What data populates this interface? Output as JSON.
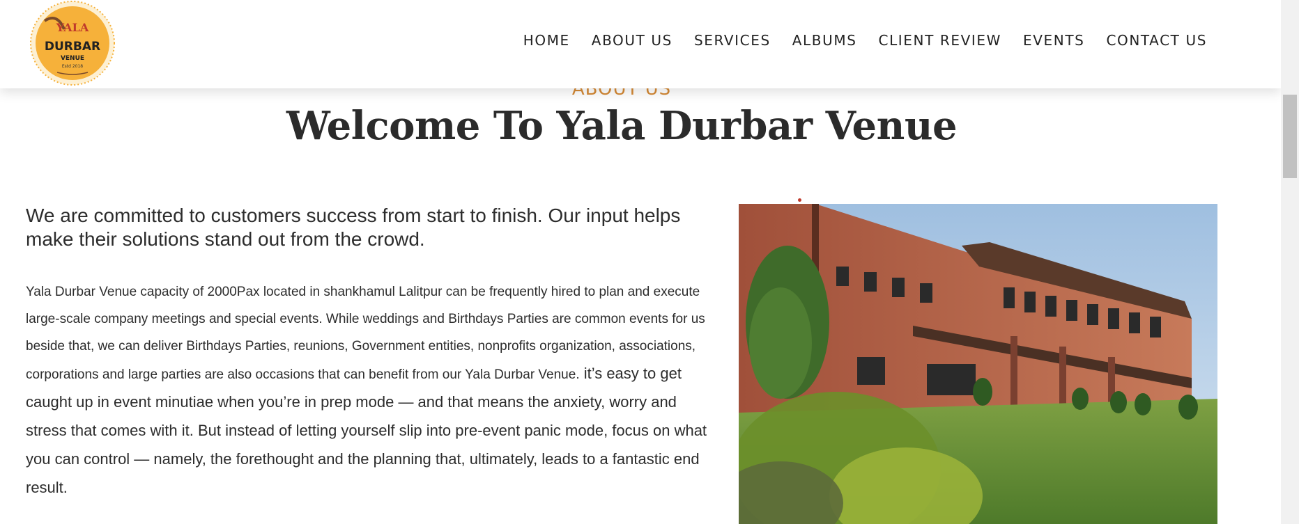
{
  "brand": {
    "logo_text_top": "YALA",
    "logo_text_main": "DURBAR",
    "logo_text_sub": "VENUE",
    "logo_text_est": "Estd 2018",
    "accent_color": "#f6b13a"
  },
  "nav": {
    "items": [
      {
        "label": "HOME"
      },
      {
        "label": "ABOUT US"
      },
      {
        "label": "SERVICES"
      },
      {
        "label": "ALBUMS"
      },
      {
        "label": "CLIENT REVIEW"
      },
      {
        "label": "EVENTS"
      },
      {
        "label": "CONTACT US"
      }
    ]
  },
  "section": {
    "eyebrow": "ABOUT US",
    "title": "Welcome To Yala Durbar Venue",
    "lead": "We are committed to customers success from start to finish. Our input helps make their solutions stand out from the crowd.",
    "body_part1": "Yala Durbar Venue capacity of 2000Pax located in shankhamul Lalitpur  can be frequently hired to plan and execute large-scale company meetings and special events. While weddings and Birthdays Parties are common events for us beside that, we can deliver Birthdays Parties, reunions, Government entities, nonprofits organization, associations, corporations and large parties are also occasions that can benefit from our Yala Durbar Venue.",
    "body_part2": " it’s easy to get caught up in event minutiae when you’re in prep mode — and that means the anxiety, worry and stress that comes with it. But instead of letting yourself slip into pre-event panic mode, focus on what you can control — namely, the forethought and the planning that, ultimately, leads to a fantastic end result."
  },
  "colors": {
    "eyebrow": "#d58a36",
    "text": "#2c2c2c"
  }
}
